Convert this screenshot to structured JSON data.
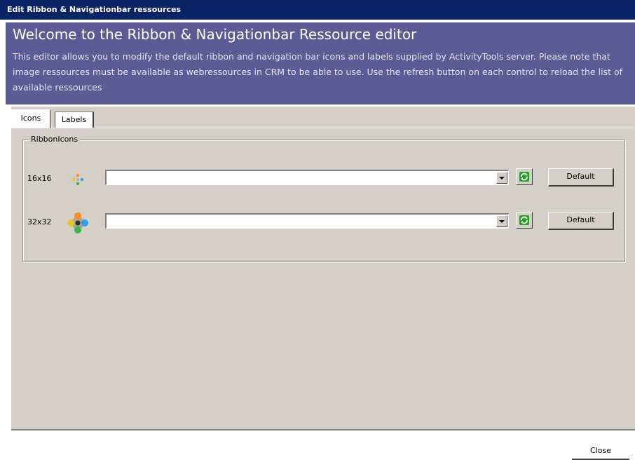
{
  "window": {
    "title": "Edit Ribbon & Navigationbar ressources"
  },
  "banner": {
    "title": "Welcome to the Ribbon & Navigationbar Ressource editor",
    "description": "This editor allows you to modify the default ribbon and navigation bar icons and labels supplied by ActivityTools server. Please note that image ressources must be available as webressources in CRM to be able to use. Use the refresh button on each control to reload the list of available ressources"
  },
  "tabs": [
    {
      "label": "Icons",
      "selected": true
    },
    {
      "label": "Labels",
      "selected": false
    }
  ],
  "group": {
    "title": "RibbonIcons",
    "rows": [
      {
        "size_label": "16x16",
        "icon": "ribbon-icon-small",
        "combo_value": "",
        "default_label": "Default"
      },
      {
        "size_label": "32x32",
        "icon": "ribbon-icon-large",
        "combo_value": "",
        "default_label": "Default"
      }
    ]
  },
  "footer": {
    "close_label": "Close"
  },
  "colors": {
    "titlebar": "#0b2466",
    "banner": "#5b5b96",
    "panel": "#d4d0c8",
    "refresh_green": "#1fa31f"
  }
}
